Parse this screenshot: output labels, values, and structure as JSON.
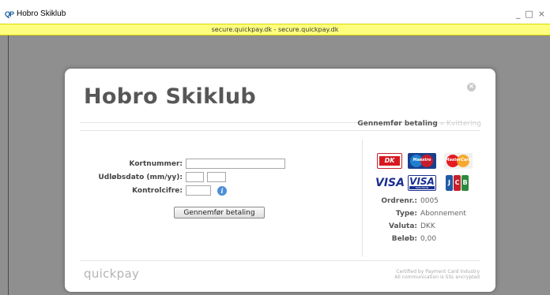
{
  "window": {
    "title": "Hobro Skiklub",
    "app_icon": "QP",
    "minimize_glyph": "_",
    "maximize_glyph": "□",
    "close_glyph": "×"
  },
  "url_bar": {
    "text": "secure.quickpay.dk - secure.quickpay.dk"
  },
  "dialog": {
    "title": "Hobro Skiklub",
    "close_glyph": "×",
    "steps": {
      "active": "Gennemfør betaling",
      "separator": "»",
      "inactive": "Kvittering"
    },
    "form": {
      "card_number_label": "Kortnummer:",
      "card_number_value": "",
      "expiry_label": "Udløbsdato (mm/yy):",
      "expiry_month_value": "",
      "expiry_year_value": "",
      "cvc_label": "Kontrolcifre:",
      "cvc_value": "",
      "info_glyph": "i",
      "submit_label": "Gennemfør betaling"
    },
    "cards": {
      "dk": "DK",
      "maestro": "Maestro",
      "mastercard": "MasterCard",
      "visa": "VISA",
      "visa_electron": "VISA",
      "visa_electron_sub": "ELECTRON",
      "jcb": "JCB"
    },
    "order": {
      "order_no_label": "Ordrenr.:",
      "order_no_value": "0005",
      "type_label": "Type:",
      "type_value": "Abonnement",
      "currency_label": "Valuta:",
      "currency_value": "DKK",
      "amount_label": "Beløb:",
      "amount_value": "0,00"
    },
    "footer": {
      "brand": "quickpay",
      "cert_line1": "Certified by Payment Card Industry",
      "cert_line2": "All communication is SSL encrypted"
    }
  },
  "colors": {
    "overlay": "#8f8f8f",
    "url_bar": "#ffff7f",
    "title_text": "#575757",
    "accent_blue": "#4d8fd6"
  }
}
